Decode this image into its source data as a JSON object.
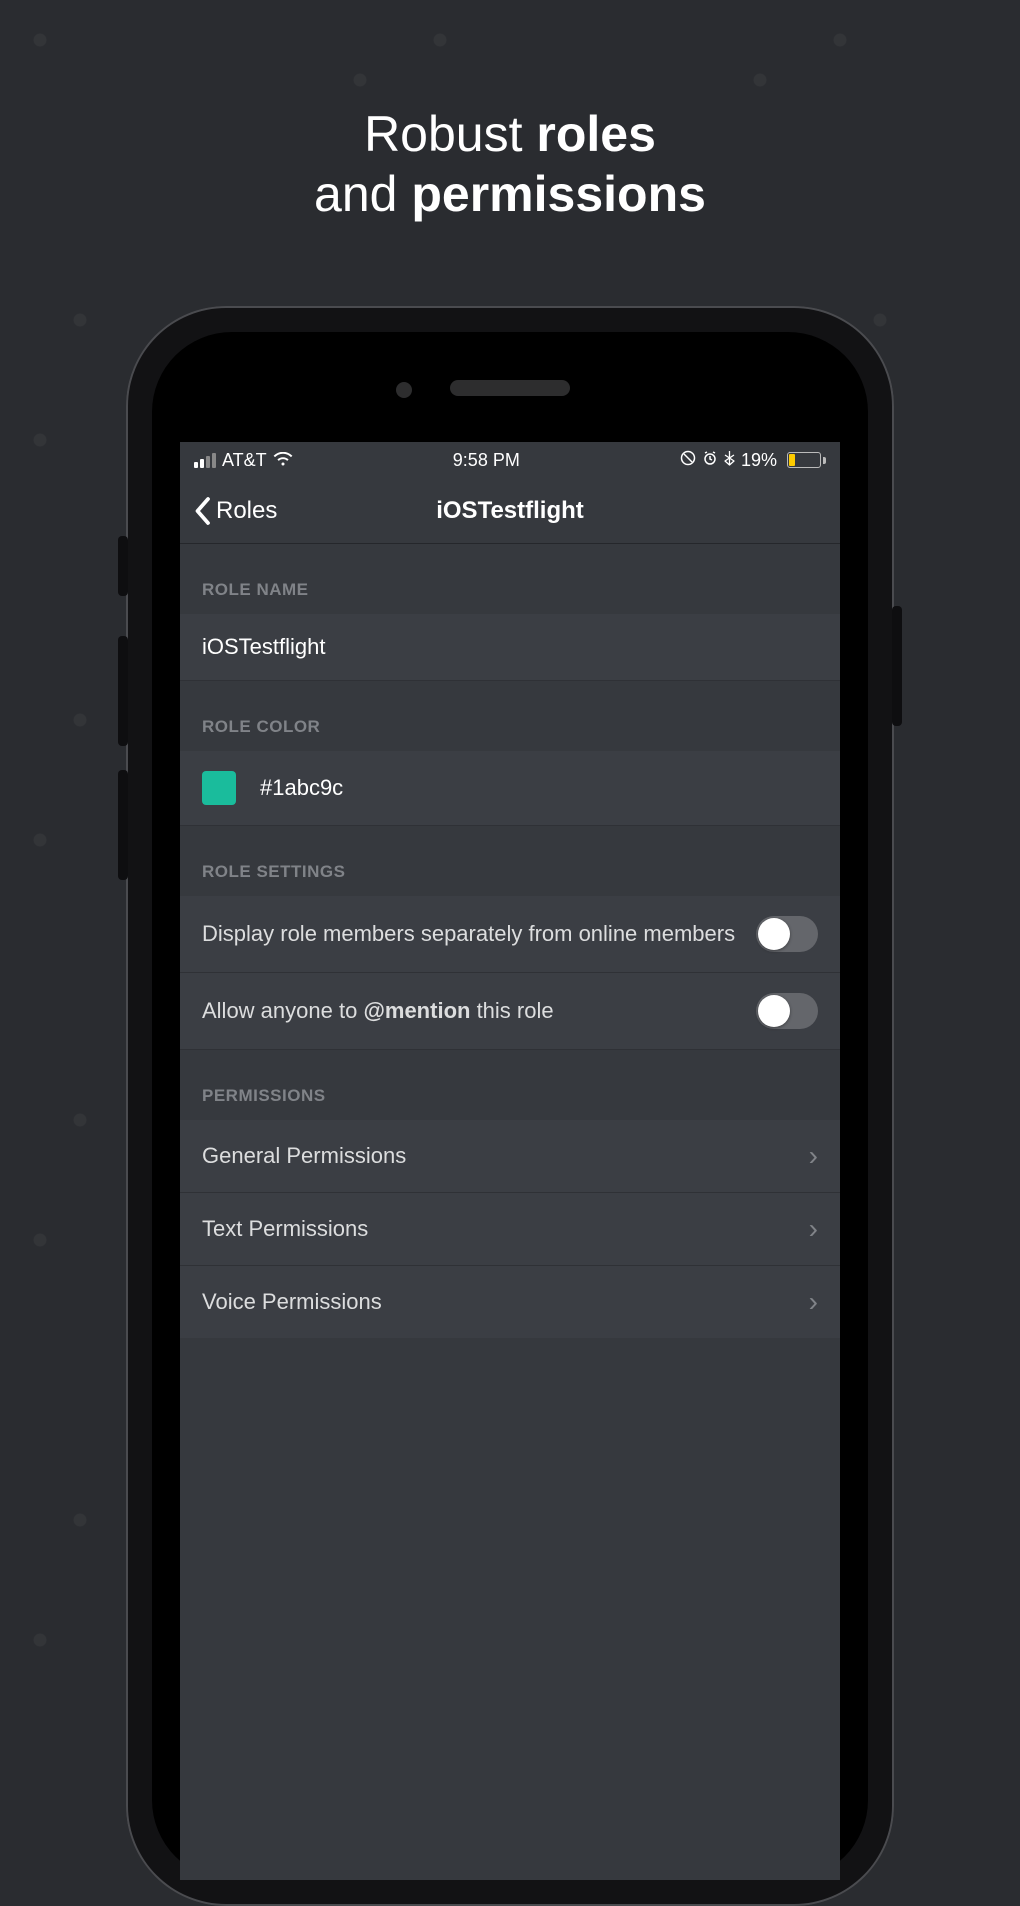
{
  "headline": {
    "line1_pre": "Robust ",
    "line1_bold": "roles",
    "line2_pre": "and ",
    "line2_bold": "permissions"
  },
  "status": {
    "carrier": "AT&T",
    "time": "9:58 PM",
    "battery_pct": "19%"
  },
  "nav": {
    "back_label": "Roles",
    "title": "iOSTestflight"
  },
  "sections": {
    "role_name_header": "ROLE NAME",
    "role_color_header": "ROLE COLOR",
    "role_settings_header": "ROLE SETTINGS",
    "permissions_header": "PERMISSIONS"
  },
  "role": {
    "name_value": "iOSTestflight",
    "color_hex": "#1abc9c"
  },
  "settings": {
    "display_separately": "Display role members separately from online members",
    "mention_pre": "Allow anyone to ",
    "mention_bold": "@mention",
    "mention_post": " this role"
  },
  "permissions": {
    "general": "General Permissions",
    "text": "Text Permissions",
    "voice": "Voice Permissions"
  }
}
